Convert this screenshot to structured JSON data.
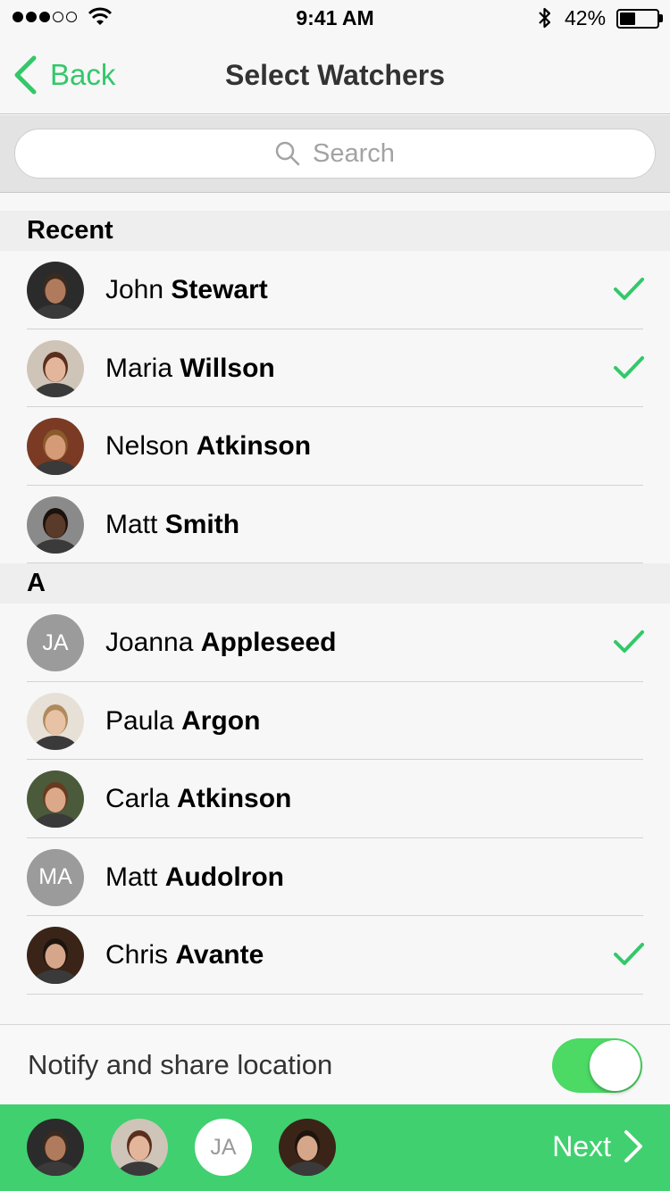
{
  "status_bar": {
    "time": "9:41 AM",
    "battery_percent": "42%",
    "battery_level": 0.42,
    "signal_bars": 3
  },
  "nav": {
    "back_label": "Back",
    "title": "Select Watchers"
  },
  "search": {
    "placeholder": "Search"
  },
  "sections": [
    {
      "header": "Recent",
      "contacts": [
        {
          "first": "John",
          "last": "Stewart",
          "avatar": "photo",
          "skin": "#b07b5c",
          "hair": "#3a2a20",
          "bg": "#2b2b2b",
          "checked": true
        },
        {
          "first": "Maria",
          "last": "Willson",
          "avatar": "photo",
          "skin": "#e3b59b",
          "hair": "#5a2e1c",
          "bg": "#cfc4b8",
          "checked": true
        },
        {
          "first": "Nelson",
          "last": "Atkinson",
          "avatar": "photo",
          "skin": "#d49b76",
          "hair": "#8a5a2c",
          "bg": "#7a3a24",
          "checked": false
        },
        {
          "first": "Matt",
          "last": "Smith",
          "avatar": "photo",
          "skin": "#5a3a28",
          "hair": "#1a120c",
          "bg": "#8a8a8a",
          "checked": false
        }
      ]
    },
    {
      "header": "A",
      "contacts": [
        {
          "first": "Joanna",
          "last": "Appleseed",
          "avatar": "initials",
          "initials": "JA",
          "checked": true
        },
        {
          "first": "Paula",
          "last": "Argon",
          "avatar": "photo",
          "skin": "#e8c2a4",
          "hair": "#b08a5c",
          "bg": "#e6e0d6",
          "checked": false
        },
        {
          "first": "Carla",
          "last": "Atkinson",
          "avatar": "photo",
          "skin": "#dba88a",
          "hair": "#6a3a1e",
          "bg": "#4a5a3a",
          "checked": false
        },
        {
          "first": "Matt",
          "last": "Audolron",
          "avatar": "initials",
          "initials": "MA",
          "checked": false
        },
        {
          "first": "Chris",
          "last": "Avante",
          "avatar": "photo",
          "skin": "#d6a68a",
          "hair": "#1e140e",
          "bg": "#3a2418",
          "checked": true
        }
      ]
    }
  ],
  "notify": {
    "label": "Notify and share location",
    "enabled": true
  },
  "selected": [
    {
      "avatar": "photo",
      "skin": "#b07b5c",
      "hair": "#3a2a20",
      "bg": "#2b2b2b"
    },
    {
      "avatar": "photo",
      "skin": "#e3b59b",
      "hair": "#5a2e1c",
      "bg": "#cfc4b8"
    },
    {
      "avatar": "initials",
      "initials": "JA"
    },
    {
      "avatar": "photo",
      "skin": "#d6a68a",
      "hair": "#1e140e",
      "bg": "#3a2418"
    }
  ],
  "bottom": {
    "next_label": "Next"
  },
  "colors": {
    "accent": "#33c86a",
    "bottom_bar": "#41d06f",
    "toggle_on": "#4cd964",
    "initials_bg": "#9b9b9b"
  }
}
